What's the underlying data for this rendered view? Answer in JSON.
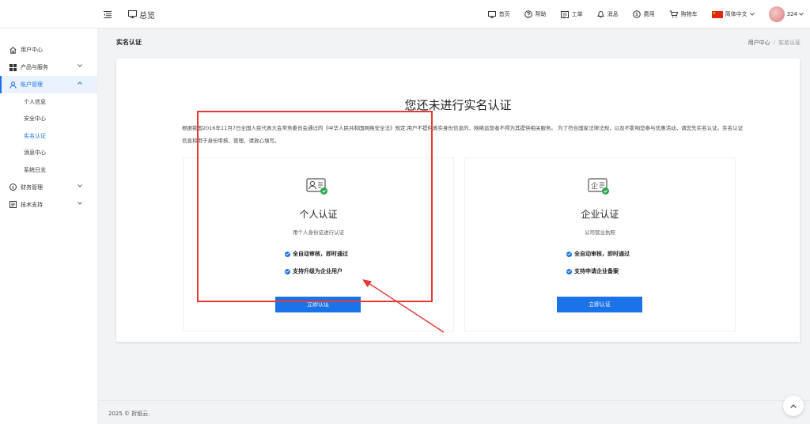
{
  "header": {
    "overview_label": "总览",
    "items": [
      {
        "label": "首页",
        "icon": "monitor-icon"
      },
      {
        "label": "帮助",
        "icon": "help-icon"
      },
      {
        "label": "工单",
        "icon": "ticket-icon"
      },
      {
        "label": "消息",
        "icon": "bell-icon"
      },
      {
        "label": "费用",
        "icon": "dollar-icon"
      },
      {
        "label": "购物车",
        "icon": "cart-icon"
      }
    ],
    "language": "简体中文",
    "user": "324"
  },
  "sidebar": {
    "items": [
      {
        "label": "用户中心"
      },
      {
        "label": "产品与服务"
      },
      {
        "label": "账户管理"
      },
      {
        "label": "财务管理"
      },
      {
        "label": "技术支持"
      }
    ],
    "sub_items": [
      {
        "label": "个人信息"
      },
      {
        "label": "安全中心"
      },
      {
        "label": "实名认证"
      },
      {
        "label": "消息中心"
      },
      {
        "label": "系统日志"
      }
    ]
  },
  "page": {
    "title": "实名认证",
    "breadcrumb": [
      "用户中心",
      "实名认证"
    ]
  },
  "card": {
    "heading": "您还未进行实名认证",
    "notice": "根据我国2016年11月7日全国人民代表大会常务委员会通过的《中华人民共和国网络安全法》规定,用户不提供真实身份信息的，网络运营者不得为其提供相关服务。 为了符合国家法律法规，以及不影响您参与优惠活动，请您先实名认证。实名认证信息将用于身份审核、管理，请放心填写。"
  },
  "options": {
    "personal": {
      "title": "个人认证",
      "subtitle": "用个人身份证进行认证",
      "features": [
        "全自动审核，即时通过",
        "支持升级为企业用户"
      ],
      "button": "立即认证"
    },
    "enterprise": {
      "title": "企业认证",
      "subtitle": "公司营业执照",
      "features": [
        "全自动审核，即时通过",
        "支持申请企业备案"
      ],
      "button": "立即认证"
    }
  },
  "footer": {
    "copyright": "2025 © 折纸云."
  },
  "colors": {
    "accent": "#1a73e8",
    "annotation_red": "#e53935",
    "check_green": "#2ea44f"
  }
}
